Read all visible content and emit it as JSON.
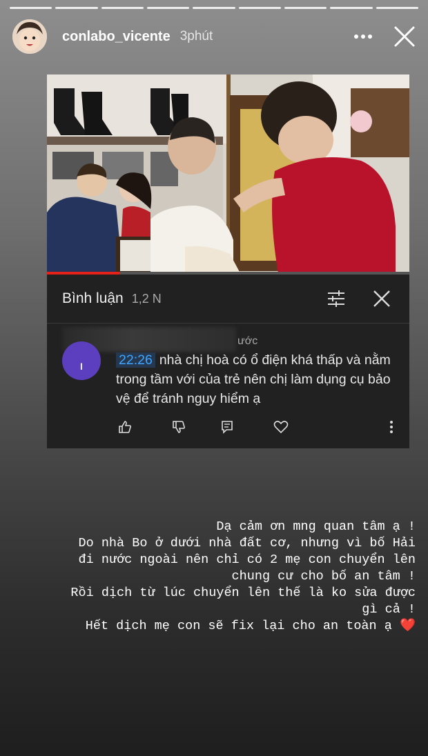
{
  "story": {
    "progress_segments": 9,
    "username": "conlabo_vicente",
    "time": "3phút"
  },
  "card": {
    "comments_title": "Bình luận",
    "comments_count": "1,2 N",
    "video_progress_fraction": 0.2,
    "comment": {
      "meta": "ước",
      "avatar_letter": "I",
      "timestamp": "22:26",
      "text": "nhà chị hoà có ổ điện khá thấp và nằm trong tầm với của trẻ nên chị làm dụng cụ bảo vệ để tránh nguy hiểm ạ"
    },
    "icons": [
      "filter-icon",
      "close-icon",
      "like-icon",
      "dislike-icon",
      "reply-icon",
      "heart-icon",
      "more-vertical-icon"
    ]
  },
  "caption": {
    "lines": [
      "Dạ cảm ơn mng quan tâm ạ !",
      "Do nhà Bo ở dưới nhà đất cơ, nhưng vì bố Hải",
      "đi nước ngoài nên chỉ có 2 mẹ con chuyển lên",
      "chung cư cho bố an tâm !",
      "Rồi dịch từ lúc chuyển lên thế là ko sửa được",
      "gì cả !",
      "Hết dịch mẹ con sẽ fix lại cho an toàn ạ"
    ],
    "emoji": "❤️"
  },
  "colors": {
    "accent_red": "#e62117",
    "timestamp_blue": "#3ea6ff",
    "heart": "#e0262a"
  }
}
